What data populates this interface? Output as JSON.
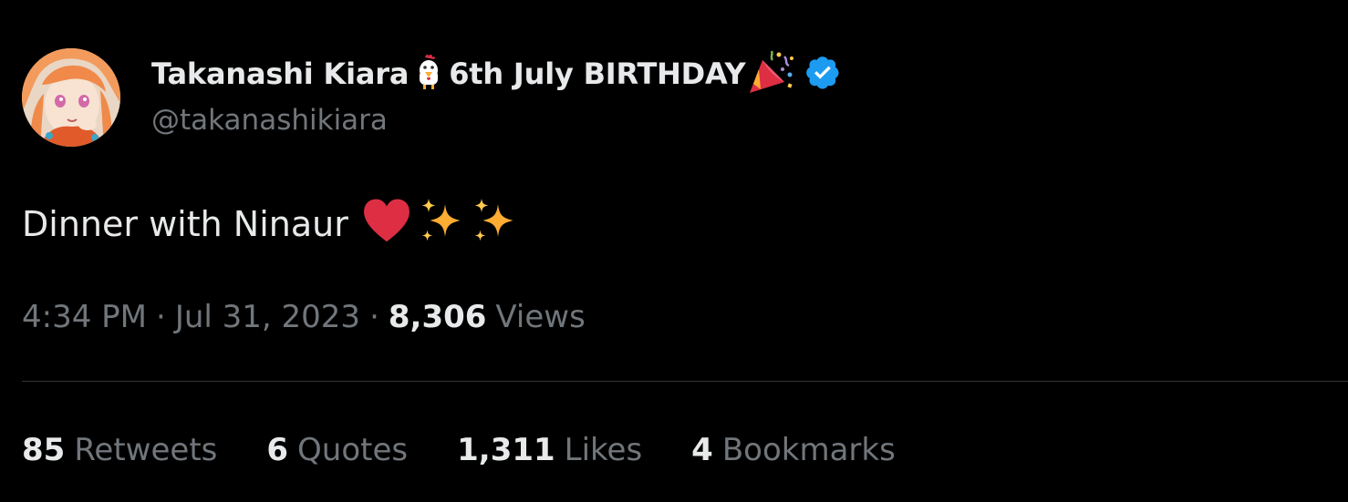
{
  "author": {
    "display_name": "Takanashi Kiara",
    "display_name_suffix": "6th July BIRTHDAY",
    "handle": "@takanashikiara",
    "verified": true,
    "avatar_icon": "anime-avatar-icon",
    "name_icons": [
      "chicken-icon",
      "party-popper-icon",
      "verified-badge-icon"
    ]
  },
  "tweet": {
    "text": "Dinner with Ninaur",
    "text_icons": [
      "red-heart-icon",
      "sparkles-icon",
      "sparkles-icon"
    ],
    "time": "4:34 PM",
    "separator": "·",
    "date": "Jul 31, 2023",
    "views_count": "8,306",
    "views_label": "Views"
  },
  "stats": [
    {
      "count": "85",
      "label": "Retweets"
    },
    {
      "count": "6",
      "label": "Quotes"
    },
    {
      "count": "1,311",
      "label": "Likes"
    },
    {
      "count": "4",
      "label": "Bookmarks"
    }
  ],
  "colors": {
    "background": "#000000",
    "primary_text": "#e7e9ea",
    "secondary_text": "#71767b",
    "divider": "#2f3336",
    "verified_blue": "#1d9bf0",
    "heart_red": "#dd2e44",
    "sparkle_yellow": "#ffac33"
  }
}
